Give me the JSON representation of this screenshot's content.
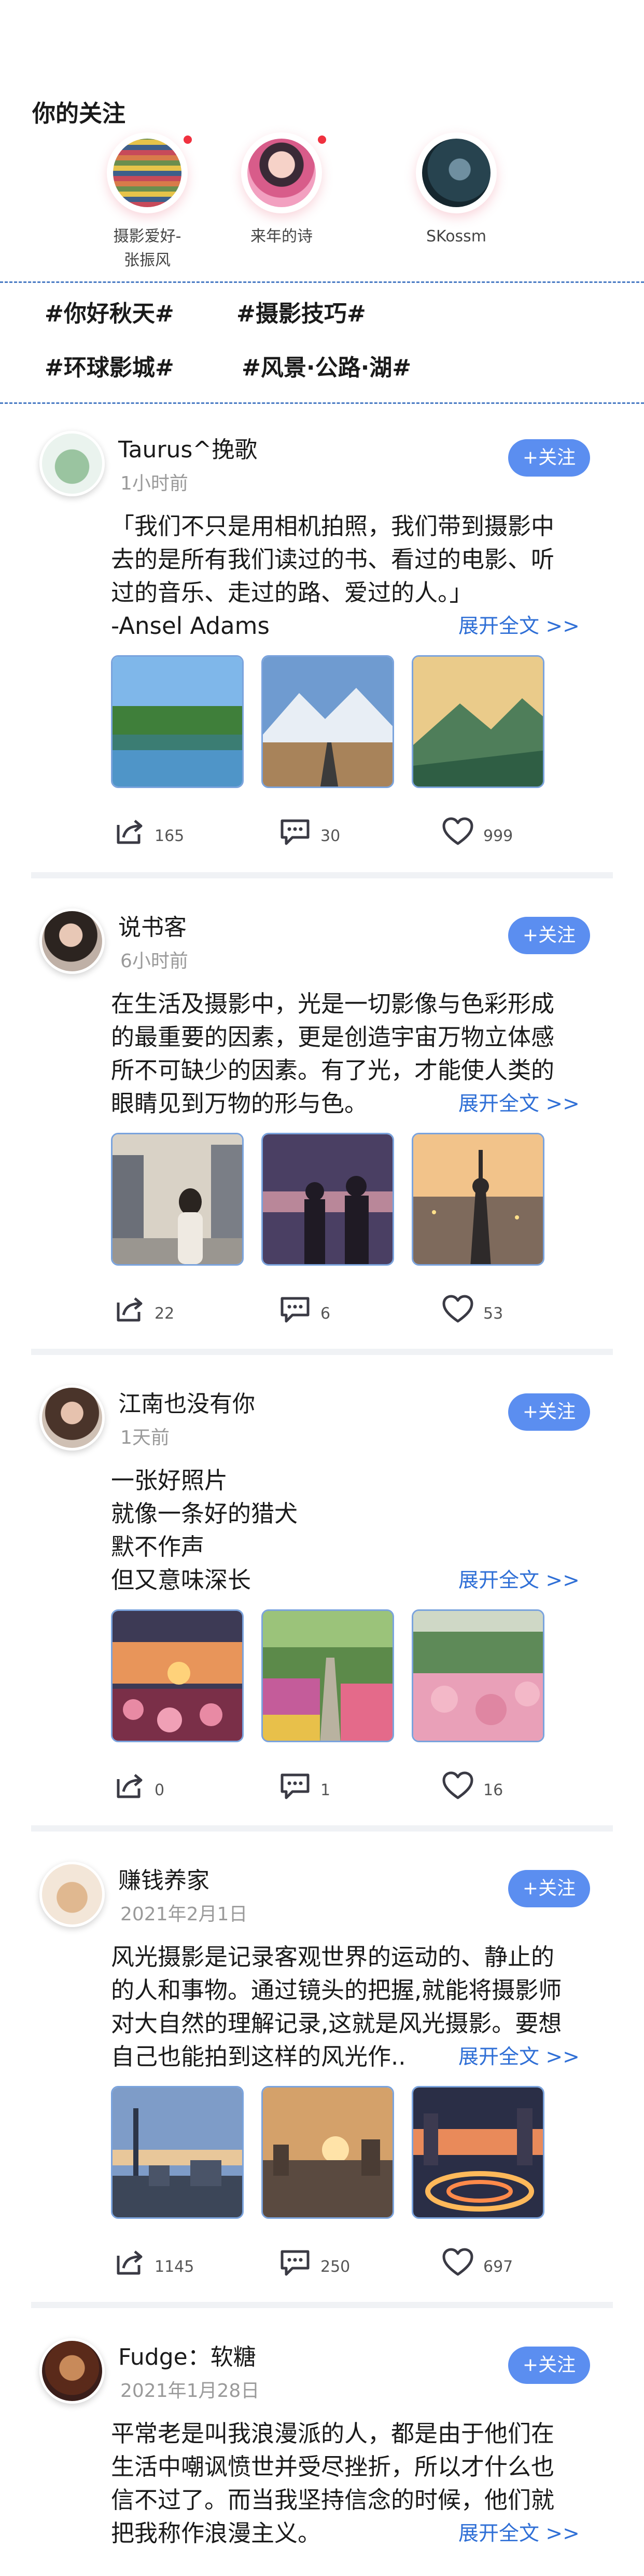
{
  "following": {
    "title": "你的关注",
    "users": [
      {
        "name_line1": "摄影爱好-",
        "name_line2": "张振风",
        "has_update": true
      },
      {
        "name_line1": "来年的诗",
        "name_line2": "",
        "has_update": true
      },
      {
        "name_line1": "SKossm",
        "name_line2": "",
        "has_update": false
      }
    ]
  },
  "topics": [
    "#你好秋天#",
    "#摄影技巧#",
    "#环球影城#",
    "#风景·公路·湖#"
  ],
  "colors": {
    "accent": "#5b8ef0",
    "link": "#2f6fd6",
    "dashed_divider": "#4a7bc4",
    "red_dot": "#f0313f"
  },
  "follow_button_label": "+关注",
  "expand_label": "展开全文 >>",
  "posts": [
    {
      "user": "Taurus^挽歌",
      "time": "1小时前",
      "lines": [
        "「我们不只是用相机拍照，我们带到摄影中",
        "去的是所有我们读过的书、看过的电影、听",
        "过的音乐、走过的路、爱过的人。」",
        "-Ansel Adams"
      ],
      "shares": "165",
      "comments": "30",
      "likes": "999",
      "images": [
        "lake",
        "road",
        "valley"
      ]
    },
    {
      "user": "说书客",
      "time": "6小时前",
      "lines": [
        "在生活及摄影中，光是一切影像与色彩形成",
        "的最重要的因素，更是创造宇宙万物立体感",
        "所不可缺少的因素。有了光，才能使人类的",
        "眼睛见到万物的形与色。"
      ],
      "shares": "22",
      "comments": "6",
      "likes": "53",
      "images": [
        "street-girl",
        "night-couple",
        "sunset-city"
      ]
    },
    {
      "user": "江南也没有你",
      "time": "1天前",
      "lines": [
        "一张好照片",
        "就像一条好的猎犬",
        "默不作声",
        "但又意味深长"
      ],
      "shares": "0",
      "comments": "1",
      "likes": "16",
      "images": [
        "flower-sunset",
        "garden-path",
        "pink-flowers"
      ]
    },
    {
      "user": "赚钱养家",
      "time": "2021年2月1日",
      "lines": [
        "风光摄影是记录客观世界的运动的、静止的",
        "的人和事物。通过镜头的把握,就能将摄影师",
        "对大自然的理解记录,这就是风光摄影。要想",
        "自己也能拍到这样的风光作.."
      ],
      "shares": "1145",
      "comments": "250",
      "likes": "697",
      "images": [
        "city-tower",
        "sunrise-city",
        "night-bridge"
      ]
    },
    {
      "user": "Fudge：软糖",
      "time": "2021年1月28日",
      "lines": [
        "平常老是叫我浪漫派的人，都是由于他们在",
        "生活中嘲讽愤世并受尽挫折，所以才什么也",
        "信不过了。而当我坚持信念的时候，他们就",
        "把我称作浪漫主义。"
      ],
      "shares": "",
      "comments": "",
      "likes": "",
      "images": []
    }
  ]
}
